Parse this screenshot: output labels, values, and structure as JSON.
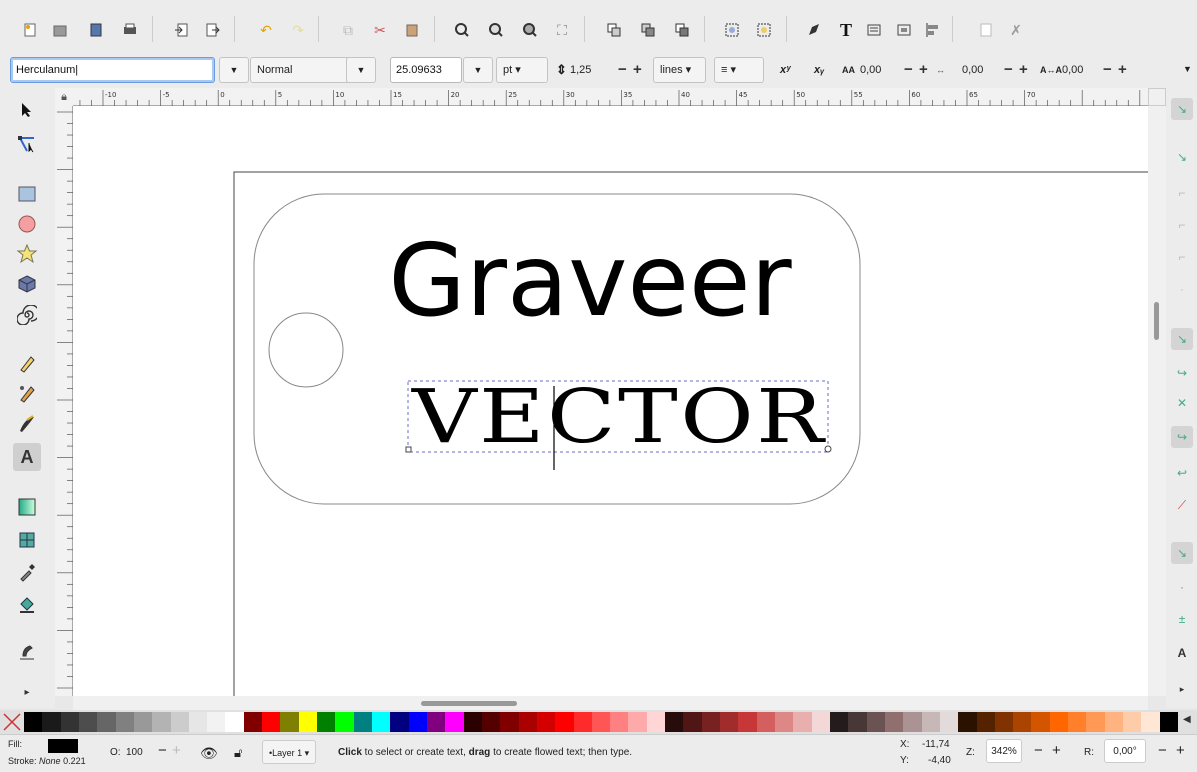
{
  "text_toolbar": {
    "font_family": "Herculanum|",
    "font_style": "Normal",
    "font_size": "25.09633",
    "unit": "pt",
    "line_height": "1,25",
    "line_height_unit": "lines",
    "letter_spacing": "0,00",
    "word_spacing": "0,00",
    "kerning": "0,00",
    "superscript_icon": "xʸ",
    "subscript_icon": "xᵧ",
    "letter_spacing_glyph": "AA",
    "word_spacing_glyph": "↔",
    "kerning_glyph": "A↔A"
  },
  "ruler": {
    "h_labels": [
      "-10",
      "-5",
      "0",
      "5",
      "10",
      "15",
      "20",
      "25",
      "30",
      "35",
      "40",
      "45",
      "50",
      "55",
      "60",
      "65",
      "70"
    ]
  },
  "canvas": {
    "title_text": "Graveer",
    "vector_text": "VECTOR"
  },
  "palette": {
    "colors": [
      "#000000",
      "#1a1a1a",
      "#333333",
      "#4d4d4d",
      "#666666",
      "#808080",
      "#999999",
      "#b3b3b3",
      "#cccccc",
      "#e6e6e6",
      "#f2f2f2",
      "#ffffff",
      "#800000",
      "#ff0000",
      "#808000",
      "#ffff00",
      "#008000",
      "#00ff00",
      "#008080",
      "#00ffff",
      "#000080",
      "#0000ff",
      "#800080",
      "#ff00ff",
      "#2b0000",
      "#550000",
      "#800000",
      "#aa0000",
      "#d40000",
      "#ff0000",
      "#ff2a2a",
      "#ff5555",
      "#ff8080",
      "#ffaaaa",
      "#ffd5d5",
      "#280b0b",
      "#501616",
      "#782121",
      "#a02c2c",
      "#c83737",
      "#d35f5f",
      "#de8787",
      "#e9afaf",
      "#f4d7d7",
      "#241c1c",
      "#483737",
      "#6c5353",
      "#916f6f",
      "#ac9393",
      "#c8b7b7",
      "#e3dbdb",
      "#2b1100",
      "#552200",
      "#803300",
      "#aa4400",
      "#d45500",
      "#ff6600",
      "#ff7f2a",
      "#ff9955",
      "#ffb380",
      "#ffccaa",
      "#ffe6d5",
      "#000000"
    ]
  },
  "status": {
    "fill_label": "Fill:",
    "stroke_label": "Stroke:",
    "stroke_value": "None",
    "stroke_width": "0.221",
    "opacity_label": "O:",
    "opacity_value": "100",
    "layer": "•Layer 1",
    "msg_click": "Click",
    "msg_1": " to select or create text, ",
    "msg_drag": "drag",
    "msg_2": " to create flowed text; then type.",
    "x_label": "X:",
    "x_value": "-11,74",
    "y_label": "Y:",
    "y_value": "-4,40",
    "zoom_label": "Z:",
    "zoom_value": "342%",
    "rotate_label": "R:",
    "rotate_value": "0,00°"
  }
}
